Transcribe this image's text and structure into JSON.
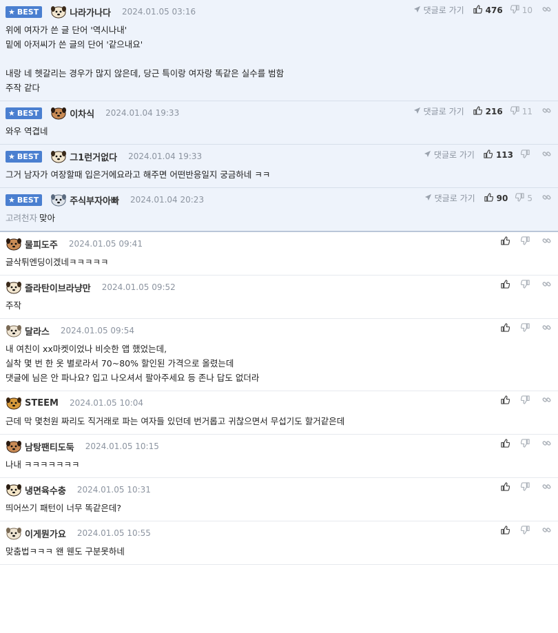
{
  "labels": {
    "best": "BEST",
    "goto_comment": "댓글로 가기"
  },
  "comments": [
    {
      "best": true,
      "nick": "나라가나다",
      "date": "2024.01.05 03:16",
      "likes": "476",
      "dislikes": "10",
      "avatar": "dog-avatar",
      "body": "위에 여자가 쓴 글 단어 '역시나내'\n밑에 아저씨가 쓴 글의 단어 '같으내요'\n\n내랑 네 헷갈리는 경우가 많지 않은데, 당근 특이랑 여자랑 똑같은 실수를 범함\n주작 같다"
    },
    {
      "best": true,
      "nick": "이차식",
      "date": "2024.01.04 19:33",
      "likes": "216",
      "dislikes": "11",
      "avatar": "brown-dog-avatar",
      "body": "와우 역겹네"
    },
    {
      "best": true,
      "nick": "그1런거없다",
      "date": "2024.01.04 19:33",
      "likes": "113",
      "dislikes": "",
      "avatar": "dog-avatar",
      "body": "그거 남자가 여장할때 입은거에요라고 해주면 어떤반응일지 궁금하네 ㅋㅋ"
    },
    {
      "best": true,
      "nick": "주식부자아빠",
      "date": "2024.01.04 20:23",
      "likes": "90",
      "dislikes": "5",
      "avatar": "gray-dog-avatar",
      "mention": "고려천자",
      "body": "맞아"
    },
    {
      "best": false,
      "nick": "물피도주",
      "date": "2024.01.05 09:41",
      "likes": "",
      "dislikes": "",
      "avatar": "brown-dog-avatar",
      "body": "글삭튀엔딩이겠네ㅋㅋㅋㅋㅋ"
    },
    {
      "best": false,
      "nick": "즐라탄이브라냥만",
      "date": "2024.01.05 09:52",
      "likes": "",
      "dislikes": "",
      "avatar": "dog-avatar",
      "body": "주작"
    },
    {
      "best": false,
      "nick": "달라스",
      "date": "2024.01.05 09:54",
      "likes": "",
      "dislikes": "",
      "avatar": "light-dog-avatar",
      "body": "내 여친이 xx마켓이었나 비슷한 앱 했었는데,\n실착 몇 번 한 옷 별로라서 70~80% 할인된 가격으로 올렸는데\n댓글에 님은 안 파나요? 입고 나오셔서 팔아주세요 등 존나 답도 없더라"
    },
    {
      "best": false,
      "nick": "STEEM",
      "date": "2024.01.05 10:04",
      "likes": "",
      "dislikes": "",
      "avatar": "lion-avatar",
      "body": "근데 막 몇천원 짜리도 직거래로 파는 여자들 있던데 번거롭고 귀찮으면서 무섭기도 할거같은데"
    },
    {
      "best": false,
      "nick": "남탕팬티도둑",
      "date": "2024.01.05 10:15",
      "likes": "",
      "dislikes": "",
      "avatar": "brown-dog-avatar",
      "body": "나내 ㅋㅋㅋㅋㅋㅋㅋ"
    },
    {
      "best": false,
      "nick": "냉면육수충",
      "date": "2024.01.05 10:31",
      "likes": "",
      "dislikes": "",
      "avatar": "fox-avatar",
      "body": "띄어쓰기 패턴이 너무 똑같은데?"
    },
    {
      "best": false,
      "nick": "이게뭔가요",
      "date": "2024.01.05 10:55",
      "likes": "",
      "dislikes": "",
      "avatar": "light-dog-avatar",
      "body": "맞춤법ㅋㅋㅋ 왠 웬도 구분못하네"
    }
  ]
}
